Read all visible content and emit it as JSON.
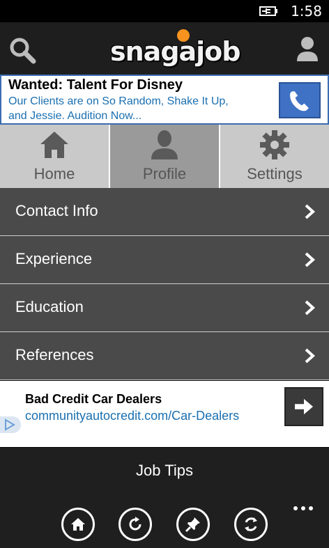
{
  "status": {
    "time": "1:58"
  },
  "header": {
    "logo_text": "snagajob",
    "icons": {
      "search": "search-icon",
      "account": "person-icon"
    }
  },
  "ad_top": {
    "title": "Wanted: Talent For Disney",
    "body": "Our Clients are on So Random, Shake It Up, and Jessie. Audition Now...",
    "icon": "phone-icon",
    "colors": {
      "border": "#3b6cb0",
      "button": "#3f72c4",
      "link": "#1a6fb0"
    }
  },
  "tabs": [
    {
      "label": "Home",
      "icon": "home-icon",
      "active": false
    },
    {
      "label": "Profile",
      "icon": "person-icon",
      "active": true
    },
    {
      "label": "Settings",
      "icon": "gear-icon",
      "active": false
    }
  ],
  "menu": {
    "items": [
      {
        "label": "Contact Info"
      },
      {
        "label": "Experience"
      },
      {
        "label": "Education"
      },
      {
        "label": "References"
      }
    ]
  },
  "ad_bottom": {
    "title": "Bad Credit Car Dealers",
    "url": "communityautocredit.com/Car-Dealers",
    "icon": "arrow-right-icon"
  },
  "app_bar": {
    "title": "Job Tips",
    "buttons": [
      "home-icon",
      "refresh-icon",
      "pin-icon",
      "sync-icon"
    ],
    "more": "more-icon"
  },
  "colors": {
    "accent": "#f7931e",
    "menu_bg": "#4a4a4a",
    "tab_bg": "#c9c9c9",
    "tab_active_bg": "#9a9a9a"
  }
}
